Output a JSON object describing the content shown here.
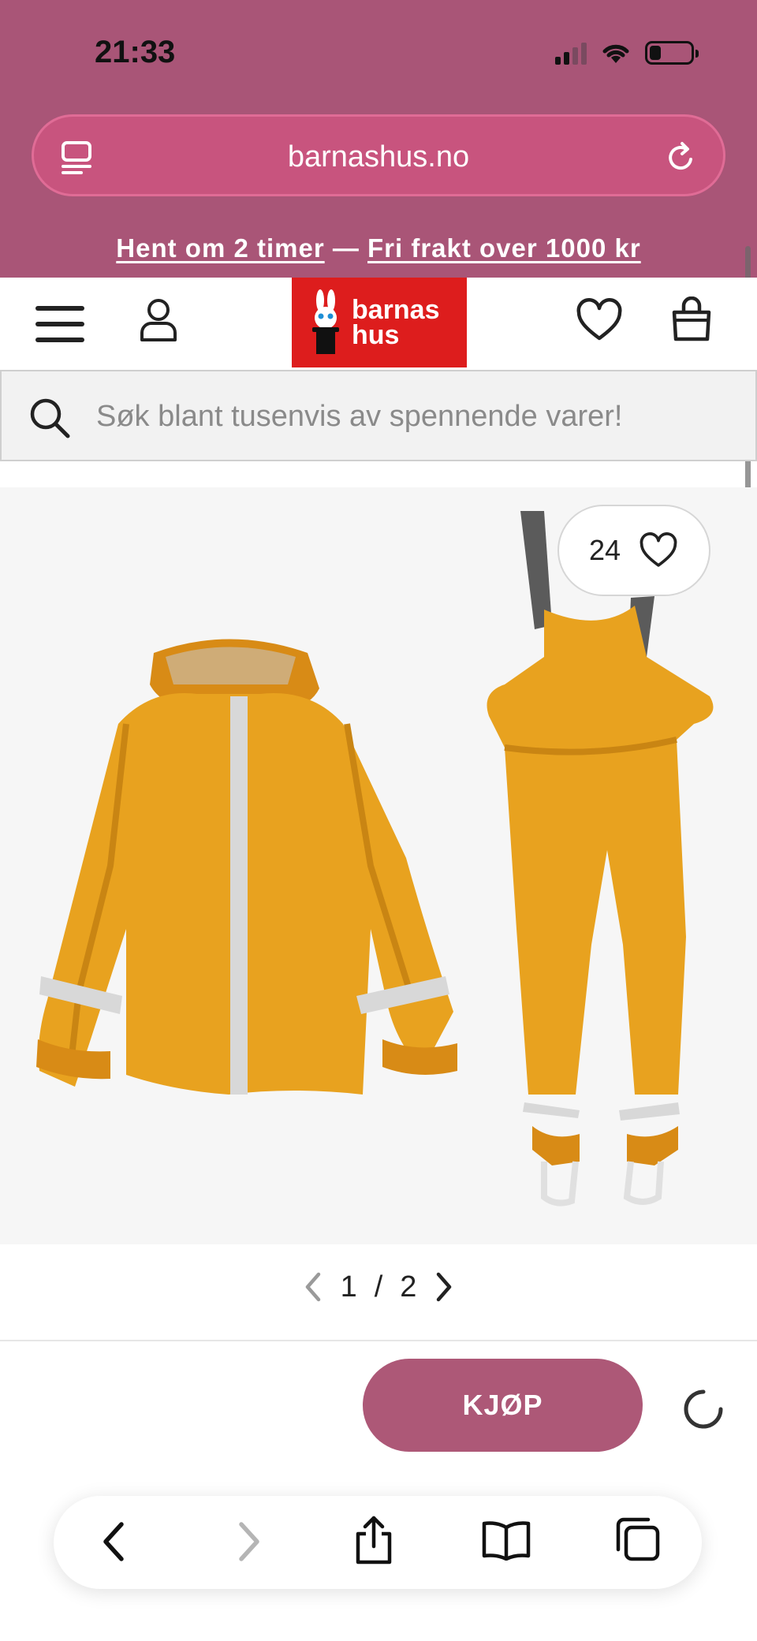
{
  "status_bar": {
    "time": "21:33"
  },
  "browser": {
    "url": "barnashus.no",
    "toolbar_icons": [
      "back-icon",
      "forward-icon",
      "share-icon",
      "bookmarks-icon",
      "tabs-icon"
    ]
  },
  "promo": {
    "part1": "Hent om 2 timer",
    "separator": " — ",
    "part2": "Fri frakt over 1000 kr"
  },
  "header": {
    "logo_line1": "barnas",
    "logo_line2": "hus",
    "icons": [
      "menu-icon",
      "user-icon",
      "heart-icon",
      "bag-icon"
    ]
  },
  "search": {
    "placeholder": "Søk blant tusenvis av spennende varer!"
  },
  "product": {
    "favorite_count": "24",
    "pager_current": "1",
    "pager_sep": "/",
    "pager_total": "2"
  },
  "buy": {
    "label": "KJØP"
  },
  "colors": {
    "chrome": "#a95577",
    "urlbar": "#c8547e",
    "logo_red": "#dd1d1d",
    "buy_button": "#ad5877",
    "product_yellow": "#e8a21f"
  }
}
